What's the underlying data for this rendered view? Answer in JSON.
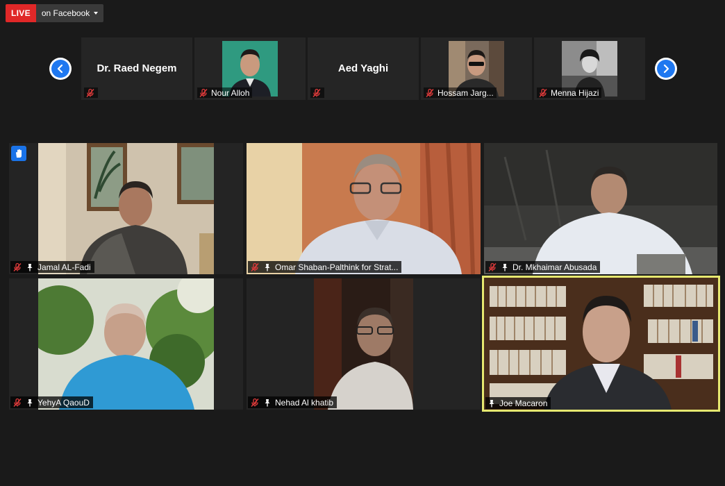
{
  "live": {
    "badge": "LIVE",
    "destination": "on Facebook"
  },
  "strip": [
    {
      "name": "Dr. Raed Negem",
      "label": "",
      "has_video": false
    },
    {
      "name": "",
      "label": "Nour Alloh",
      "has_video": true
    },
    {
      "name": "Aed Yaghi",
      "label": "",
      "has_video": false
    },
    {
      "name": "",
      "label": "Hossam Jarg...",
      "has_video": true
    },
    {
      "name": "",
      "label": "Menna Hijazi",
      "has_video": true
    }
  ],
  "tiles": [
    {
      "name": "Jamal AL-Fadi",
      "muted": true,
      "hand_raised": true
    },
    {
      "name": "Omar Shaban-Palthink for Strat...",
      "muted": true
    },
    {
      "name": "Dr. Mkhaimar Abusada",
      "muted": true
    },
    {
      "name": "YehyA QaouD",
      "muted": true
    },
    {
      "name": "Nehad Al khatib",
      "muted": true
    },
    {
      "name": "Joe Macaron",
      "muted": false,
      "active_speaker": true
    }
  ],
  "colors": {
    "live_red": "#e02828",
    "accent_blue": "#1f78f0",
    "active_border": "#e6e870",
    "mute_red": "#e03b3b"
  },
  "icons": [
    "chevron-left-icon",
    "chevron-right-icon",
    "mic-muted-icon",
    "pin-icon",
    "raised-hand-icon",
    "caret-down-icon"
  ]
}
